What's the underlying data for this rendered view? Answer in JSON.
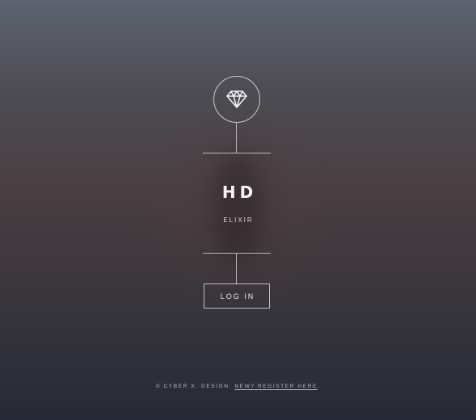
{
  "brand": {
    "logo_icon": "diamond-icon",
    "title": "HD",
    "subtitle": "ELIXIR"
  },
  "actions": {
    "login_label": "LOG IN"
  },
  "footer": {
    "copyright": "© CYBER X. DESIGN: ",
    "register_link": "NEW? REGISTER HERE",
    "trailing": "."
  }
}
